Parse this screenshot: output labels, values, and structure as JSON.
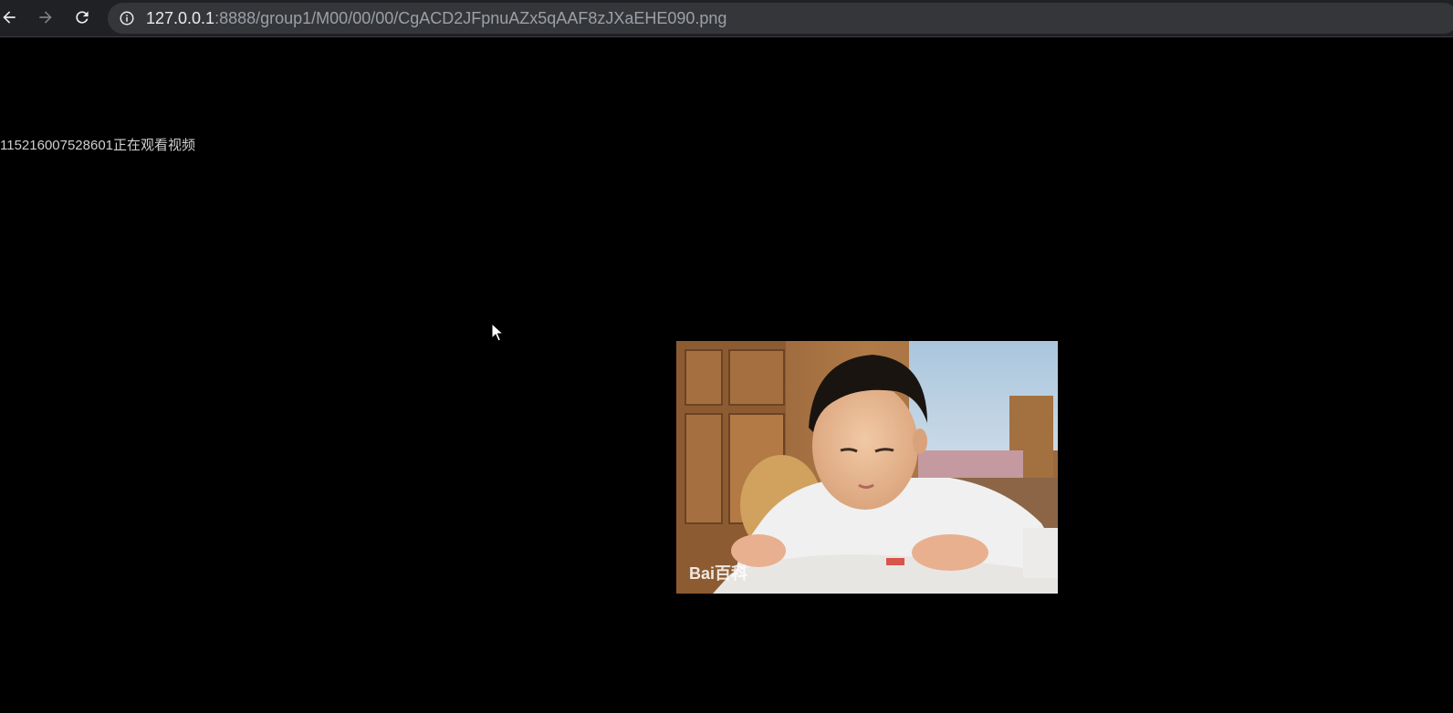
{
  "browser": {
    "url_host": "127.0.0.1",
    "url_rest": ":8888/group1/M00/00/00/CgACD2JFpnuAZx5qAAF8zJXaEHE090.png"
  },
  "page": {
    "overlay_text": "115216007528601正在观看视频",
    "image_watermark": "Bai百科"
  },
  "icons": {
    "back": "arrow-left-icon",
    "forward": "arrow-right-icon",
    "reload": "reload-icon",
    "info": "info-icon",
    "cursor": "mouse-pointer-icon"
  }
}
